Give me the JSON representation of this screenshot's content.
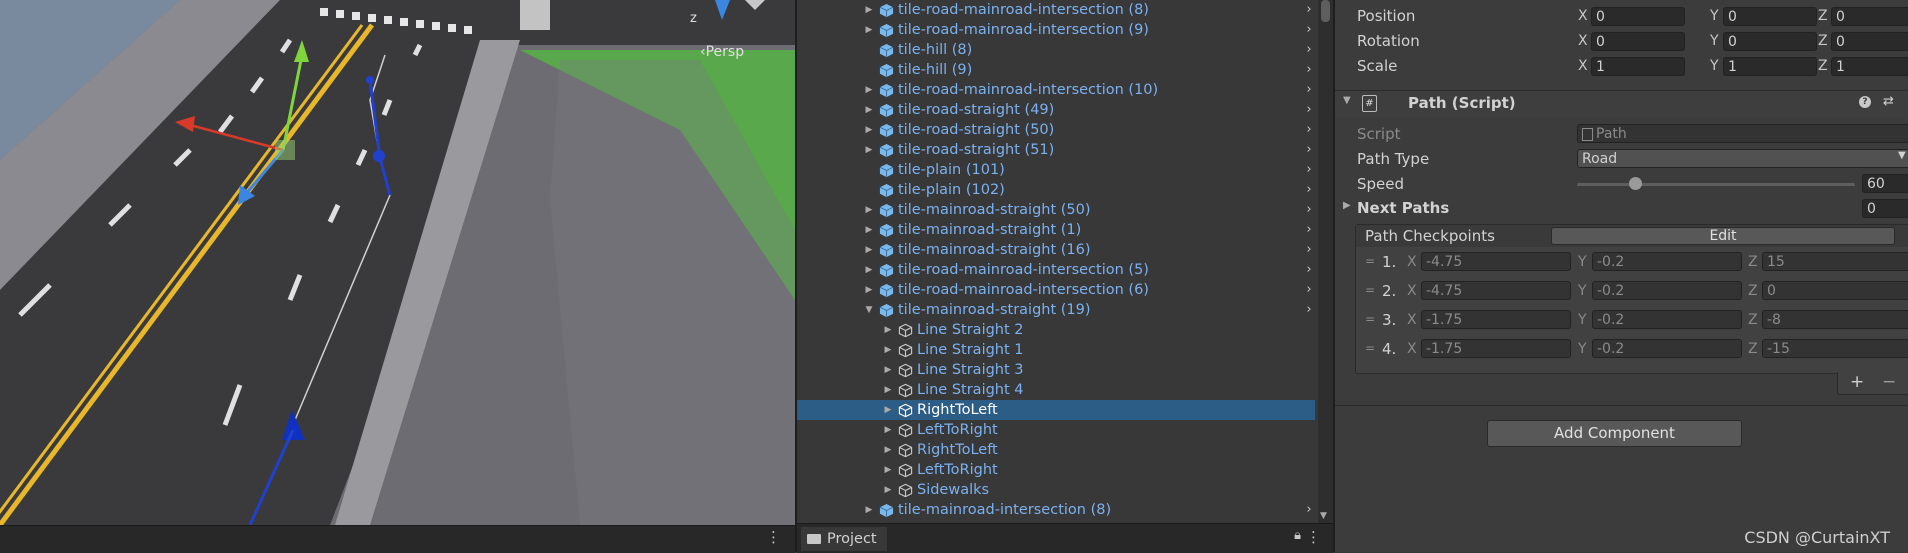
{
  "scene": {
    "persp_label": "‹Persp",
    "z_label": "z"
  },
  "hierarchy": {
    "rows": [
      {
        "label": "tile-road-mainroad-intersection (8)",
        "level": 0,
        "arrow": "right",
        "type": "prefab"
      },
      {
        "label": "tile-road-mainroad-intersection (9)",
        "level": 0,
        "arrow": "right",
        "type": "prefab"
      },
      {
        "label": "tile-hill (8)",
        "level": 0,
        "arrow": "",
        "type": "prefab"
      },
      {
        "label": "tile-hill (9)",
        "level": 0,
        "arrow": "",
        "type": "prefab"
      },
      {
        "label": "tile-road-mainroad-intersection (10)",
        "level": 0,
        "arrow": "right",
        "type": "prefab"
      },
      {
        "label": "tile-road-straight (49)",
        "level": 0,
        "arrow": "right",
        "type": "prefab"
      },
      {
        "label": "tile-road-straight (50)",
        "level": 0,
        "arrow": "right",
        "type": "prefab"
      },
      {
        "label": "tile-road-straight (51)",
        "level": 0,
        "arrow": "right",
        "type": "prefab"
      },
      {
        "label": "tile-plain (101)",
        "level": 0,
        "arrow": "",
        "type": "prefab"
      },
      {
        "label": "tile-plain (102)",
        "level": 0,
        "arrow": "",
        "type": "prefab"
      },
      {
        "label": "tile-mainroad-straight (50)",
        "level": 0,
        "arrow": "right",
        "type": "prefab"
      },
      {
        "label": "tile-mainroad-straight (1)",
        "level": 0,
        "arrow": "right",
        "type": "prefab"
      },
      {
        "label": "tile-mainroad-straight (16)",
        "level": 0,
        "arrow": "right",
        "type": "prefab"
      },
      {
        "label": "tile-road-mainroad-intersection (5)",
        "level": 0,
        "arrow": "right",
        "type": "prefab"
      },
      {
        "label": "tile-road-mainroad-intersection (6)",
        "level": 0,
        "arrow": "right",
        "type": "prefab"
      },
      {
        "label": "tile-mainroad-straight (19)",
        "level": 0,
        "arrow": "down",
        "type": "prefab"
      },
      {
        "label": "Line Straight 2",
        "level": 1,
        "arrow": "right",
        "type": "object"
      },
      {
        "label": "Line Straight 1",
        "level": 1,
        "arrow": "right",
        "type": "object"
      },
      {
        "label": "Line Straight 3",
        "level": 1,
        "arrow": "right",
        "type": "object"
      },
      {
        "label": "Line Straight 4",
        "level": 1,
        "arrow": "right",
        "type": "object"
      },
      {
        "label": "RightToLeft",
        "level": 1,
        "arrow": "right",
        "type": "object",
        "selected": true
      },
      {
        "label": "LeftToRight",
        "level": 1,
        "arrow": "right",
        "type": "object"
      },
      {
        "label": "RightToLeft",
        "level": 1,
        "arrow": "right",
        "type": "object"
      },
      {
        "label": "LeftToRight",
        "level": 1,
        "arrow": "right",
        "type": "object"
      },
      {
        "label": "Sidewalks",
        "level": 1,
        "arrow": "right",
        "type": "object"
      },
      {
        "label": "tile-mainroad-intersection (8)",
        "level": 0,
        "arrow": "right",
        "type": "prefab"
      }
    ]
  },
  "project": {
    "tab_label": "Project"
  },
  "inspector": {
    "transform": [
      {
        "label": "Position",
        "x": "0",
        "y": "0",
        "z": "0"
      },
      {
        "label": "Rotation",
        "x": "0",
        "y": "0",
        "z": "0"
      },
      {
        "label": "Scale",
        "x": "1",
        "y": "1",
        "z": "1"
      }
    ],
    "axis": {
      "x": "X",
      "y": "Y",
      "z": "Z"
    },
    "component_title": "Path (Script)",
    "script_label": "Script",
    "script_value": "Path",
    "path_type_label": "Path Type",
    "path_type_value": "Road",
    "speed_label": "Speed",
    "speed_value": "60",
    "speed_fraction": 0.21,
    "next_paths_label": "Next Paths",
    "next_paths_value": "0",
    "checkpoints_label": "Path Checkpoints",
    "edit_label": "Edit",
    "checkpoints": [
      {
        "idx": "1.",
        "x": "-4.75",
        "y": "-0.2",
        "z": "15"
      },
      {
        "idx": "2.",
        "x": "-4.75",
        "y": "-0.2",
        "z": "0"
      },
      {
        "idx": "3.",
        "x": "-1.75",
        "y": "-0.2",
        "z": "-8"
      },
      {
        "idx": "4.",
        "x": "-1.75",
        "y": "-0.2",
        "z": "-15"
      }
    ],
    "plus_label": "+",
    "minus_label": "−",
    "add_component_label": "Add Component"
  },
  "watermark": "CSDN @CurtainXT"
}
